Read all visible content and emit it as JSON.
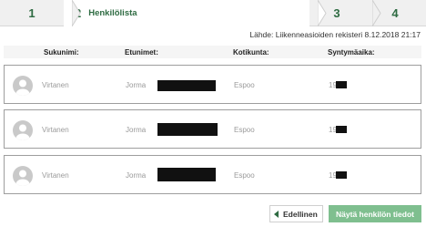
{
  "stepper": {
    "steps": [
      {
        "number": "1",
        "label": ""
      },
      {
        "number": "2",
        "label": "Henkilölista"
      },
      {
        "number": "3",
        "label": ""
      },
      {
        "number": "4",
        "label": ""
      }
    ],
    "active_step": 2
  },
  "source_text": "Lähde: Liikenneasioiden rekisteri 8.12.2018 21:17",
  "table": {
    "columns": [
      "Sukunimi:",
      "Etunimet:",
      "Kotikunta:",
      "Syntymäaika:"
    ],
    "rows": [
      {
        "sukunimi": "Virtanen",
        "etunimet": "Jorma",
        "kotikunta": "Espoo",
        "syntymaaika": "19"
      },
      {
        "sukunimi": "Virtanen",
        "etunimet": "Jorma",
        "kotikunta": "Espoo",
        "syntymaaika": "19"
      },
      {
        "sukunimi": "Virtanen",
        "etunimet": "Jorma",
        "kotikunta": "Espoo",
        "syntymaaika": "19"
      }
    ]
  },
  "buttons": {
    "previous": "Edellinen",
    "next": "Näytä henkilön tiedot"
  },
  "colors": {
    "accent": "#2e6b42",
    "button_disabled": "#7fbf8f",
    "stepper_bg": "#f0f0f0"
  },
  "icons": {
    "avatar": "user-avatar-icon",
    "previous": "triangle-left-icon"
  }
}
